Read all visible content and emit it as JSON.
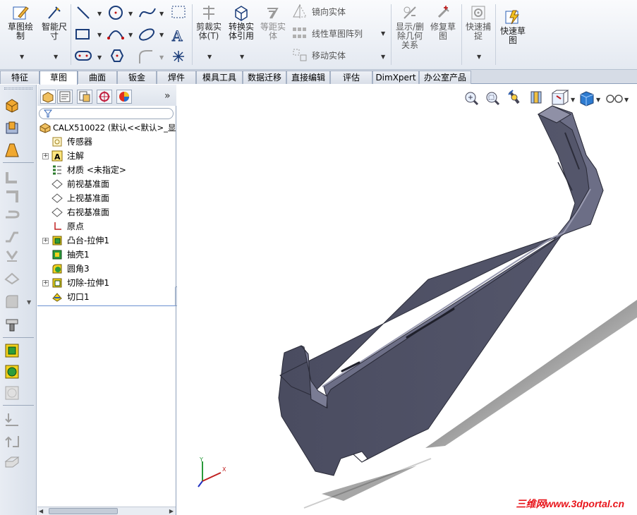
{
  "ribbon": {
    "sketch_draw": "草图绘\n制",
    "smart_dim": "智能尺\n寸",
    "trim": "剪裁实\n体(T)",
    "convert": "转换实\n体引用",
    "offset": "等距实\n体",
    "mirror": "镜向实体",
    "linear_pattern": "线性草图阵列",
    "move": "移动实体",
    "show_delete": "显示/删\n除几何\n关系",
    "repair": "修复草\n图",
    "quick_snap": "快速捕\n捉",
    "rapid_sketch": "快速草\n图"
  },
  "tabs": [
    "特征",
    "草图",
    "曲面",
    "钣金",
    "焊件",
    "模具工具",
    "数据迁移",
    "直接编辑",
    "评估",
    "DimXpert",
    "办公室产品"
  ],
  "active_tab": "草图",
  "feature_tree": {
    "root": "CALX510022  (默认<<默认>_显",
    "items": [
      {
        "label": "传感器",
        "icon": "sensor-icon",
        "expandable": false
      },
      {
        "label": "注解",
        "icon": "annotation-icon",
        "expandable": true
      },
      {
        "label": "材质 <未指定>",
        "icon": "material-icon",
        "expandable": false
      },
      {
        "label": "前视基准面",
        "icon": "plane-icon",
        "expandable": false
      },
      {
        "label": "上视基准面",
        "icon": "plane-icon",
        "expandable": false
      },
      {
        "label": "右视基准面",
        "icon": "plane-icon",
        "expandable": false
      },
      {
        "label": "原点",
        "icon": "origin-icon",
        "expandable": false
      },
      {
        "label": "凸台-拉伸1",
        "icon": "boss-extrude-icon",
        "expandable": true
      },
      {
        "label": "抽壳1",
        "icon": "shell-icon",
        "expandable": false
      },
      {
        "label": "圆角3",
        "icon": "fillet-icon",
        "expandable": false
      },
      {
        "label": "切除-拉伸1",
        "icon": "cut-extrude-icon",
        "expandable": true
      },
      {
        "label": "切口1",
        "icon": "rip-icon",
        "expandable": false
      }
    ]
  },
  "fm_tabs_more": "»",
  "watermark": "三维网www.3dportal.cn",
  "triad": {
    "x": "X",
    "y": "Y",
    "z": "Z"
  },
  "colors": {
    "part": "#4d4f63",
    "part_light": "#8f90a6",
    "accent": "#e8151b",
    "tab_bg": "#d6dce6"
  }
}
